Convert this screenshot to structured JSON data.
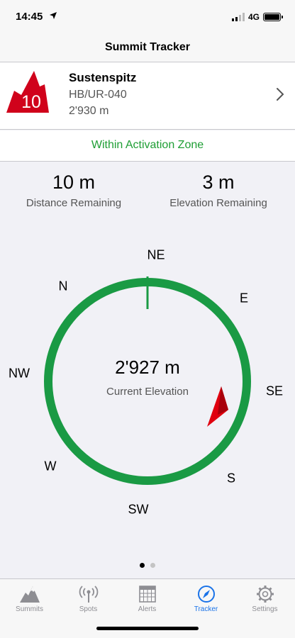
{
  "status_bar": {
    "time": "14:45",
    "network": "4G"
  },
  "nav": {
    "title": "Summit Tracker"
  },
  "summit": {
    "badge_points": "10",
    "name": "Sustenspitz",
    "reference": "HB/UR-040",
    "altitude": "2'930 m"
  },
  "zone": {
    "text": "Within Activation Zone"
  },
  "metrics": {
    "distance": {
      "value": "10 m",
      "label": "Distance Remaining"
    },
    "elevation": {
      "value": "3 m",
      "label": "Elevation Remaining"
    }
  },
  "compass": {
    "directions": {
      "ne": "NE",
      "n": "N",
      "e": "E",
      "nw": "NW",
      "se": "SE",
      "w": "W",
      "s": "S",
      "sw": "SW"
    },
    "current_elevation_value": "2'927 m",
    "current_elevation_label": "Current Elevation"
  },
  "pagination": {
    "current": 1,
    "total": 2
  },
  "tabs": [
    {
      "label": "Summits",
      "icon": "mountain-icon"
    },
    {
      "label": "Spots",
      "icon": "antenna-icon"
    },
    {
      "label": "Alerts",
      "icon": "calendar-icon"
    },
    {
      "label": "Tracker",
      "icon": "compass-icon",
      "active": true
    },
    {
      "label": "Settings",
      "icon": "gear-icon"
    }
  ],
  "colors": {
    "accent": "#1a73e8",
    "zone_green": "#1e9e34",
    "ring_green": "#1a9a44",
    "badge_red": "#d0021b",
    "pointer_red": "#e0000f"
  }
}
